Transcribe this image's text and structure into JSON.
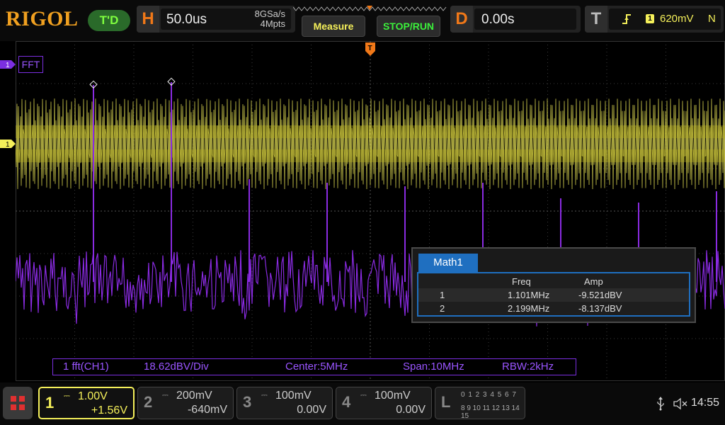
{
  "brand": "RIGOL",
  "trigger_status": "T'D",
  "horizontal": {
    "key": "H",
    "timebase": "50.0us",
    "sample_rate": "8GSa/s",
    "memory_depth": "4Mpts"
  },
  "buttons": {
    "measure": "Measure",
    "stop_run": "STOP/RUN"
  },
  "delay": {
    "key": "D",
    "value": "0.00s"
  },
  "trigger": {
    "key": "T",
    "source": "1",
    "level": "620mV",
    "mode": "N"
  },
  "markers": {
    "fft_label": "FFT",
    "ch1_marker": "1",
    "fft_marker": "1",
    "trigger_pos": "T"
  },
  "fft_info": {
    "source": "1 fft(CH1)",
    "scale": "18.62dBV/Div",
    "center": "Center:5MHz",
    "span": "Span:10MHz",
    "rbw": "RBW:2kHz"
  },
  "measure_table": {
    "tab": "Math1",
    "headers": [
      "",
      "Freq",
      "Amp"
    ],
    "rows": [
      {
        "index": "1",
        "freq": "1.101MHz",
        "amp": "-9.521dBV"
      },
      {
        "index": "2",
        "freq": "2.199MHz",
        "amp": "-8.137dBV"
      }
    ]
  },
  "channels": [
    {
      "num": "1",
      "scale": "1.00V",
      "offset": "+1.56V",
      "color": "#f5f05a",
      "active": true
    },
    {
      "num": "2",
      "scale": "200mV",
      "offset": "-640mV",
      "color": "#888888",
      "active": false
    },
    {
      "num": "3",
      "scale": "100mV",
      "offset": "0.00V",
      "color": "#888888",
      "active": false
    },
    {
      "num": "4",
      "scale": "100mV",
      "offset": "0.00V",
      "color": "#888888",
      "active": false
    }
  ],
  "logic": {
    "key": "L",
    "row1": "0 1 2 3   4 5 6 7",
    "row2": "8 9 10 11  12 13 14 15"
  },
  "status": {
    "time": "14:55"
  },
  "colors": {
    "ch1": "#f5f05a",
    "math": "#8a2be2",
    "accent": "#f07818",
    "tab": "#1f6fc0"
  }
}
